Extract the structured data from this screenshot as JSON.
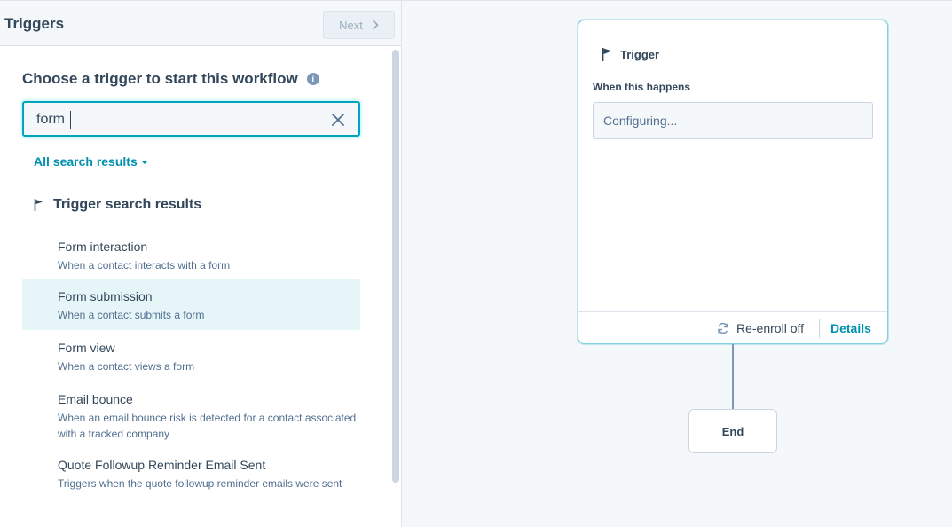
{
  "panel": {
    "title": "Triggers",
    "next_label": "Next",
    "heading": "Choose a trigger to start this workflow",
    "info_icon": "i"
  },
  "search": {
    "value": "form",
    "placeholder": ""
  },
  "filter": {
    "label": "All search results"
  },
  "results": {
    "heading": "Trigger search results",
    "items": [
      {
        "title": "Form interaction",
        "desc": "When a contact interacts with a form",
        "selected": false
      },
      {
        "title": "Form submission",
        "desc": "When a contact submits a form",
        "selected": true
      },
      {
        "title": "Form view",
        "desc": "When a contact views a form",
        "selected": false
      },
      {
        "title": "Email bounce",
        "desc": "When an email bounce risk is detected for a contact associated with a tracked company",
        "selected": false
      },
      {
        "title": "Quote Followup Reminder Email Sent",
        "desc": "Triggers when the quote followup reminder emails were sent",
        "selected": false
      },
      {
        "title": "",
        "desc": "",
        "selected": false
      }
    ]
  },
  "card": {
    "header": "Trigger",
    "when_label": "When this happens",
    "config_value": "Configuring...",
    "reenroll": "Re-enroll off",
    "details": "Details"
  },
  "end_node": {
    "label": "End"
  },
  "colors": {
    "accent": "#00a4bd",
    "link": "#0091ae",
    "selected_bg": "#e5f5f8",
    "text": "#33475b"
  }
}
